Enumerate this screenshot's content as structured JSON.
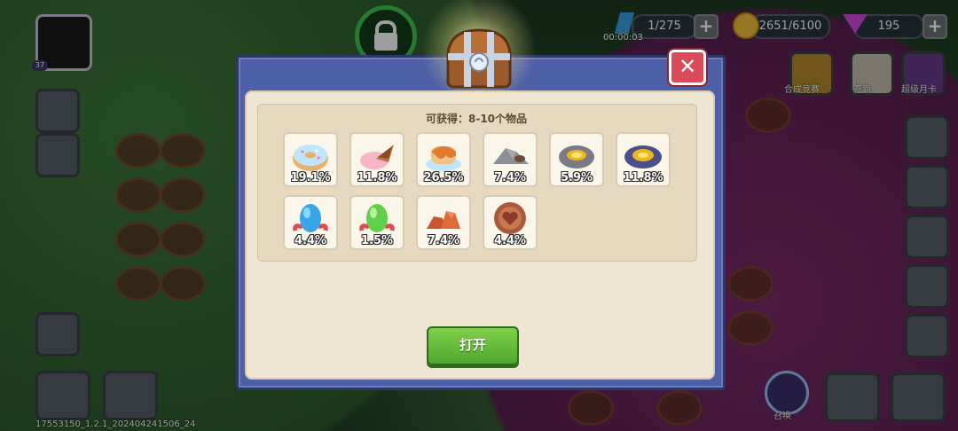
{
  "hud": {
    "energy": "1/275",
    "timer": "00:00:03",
    "coins": "2651/6100",
    "gems": "195",
    "avatar_level": "37",
    "plus_symbol": "+"
  },
  "side_labels": {
    "merge_contest": "合成竞赛",
    "sign_in": "签到",
    "super_monthly_card": "超级月卡",
    "summon": "召唤"
  },
  "build_id": "17553150_1.2.1_202404241506_24",
  "modal": {
    "title": "可获得：8-10个物品",
    "close_symbol": "✕",
    "open_button": "打开",
    "items": [
      {
        "icon": "donut-icon",
        "percent": "19.1%"
      },
      {
        "icon": "ice-cream-cone-icon",
        "percent": "11.8%"
      },
      {
        "icon": "pudding-icon",
        "percent": "26.5%"
      },
      {
        "icon": "stone-pile-icon",
        "percent": "7.4%"
      },
      {
        "icon": "lava-rock-icon",
        "percent": "5.9%"
      },
      {
        "icon": "crystal-ore-icon",
        "percent": "11.8%"
      },
      {
        "icon": "blue-egg-icon",
        "percent": "4.4%"
      },
      {
        "icon": "green-egg-icon",
        "percent": "1.5%"
      },
      {
        "icon": "rock-pile-icon",
        "percent": "7.4%"
      },
      {
        "icon": "heart-coin-icon",
        "percent": "4.4%"
      }
    ]
  },
  "colors": {
    "modal_frame": "#4d5fa6",
    "modal_inner": "#efe5d3",
    "open_button": "#5fba38",
    "close_button": "#d94b58"
  }
}
